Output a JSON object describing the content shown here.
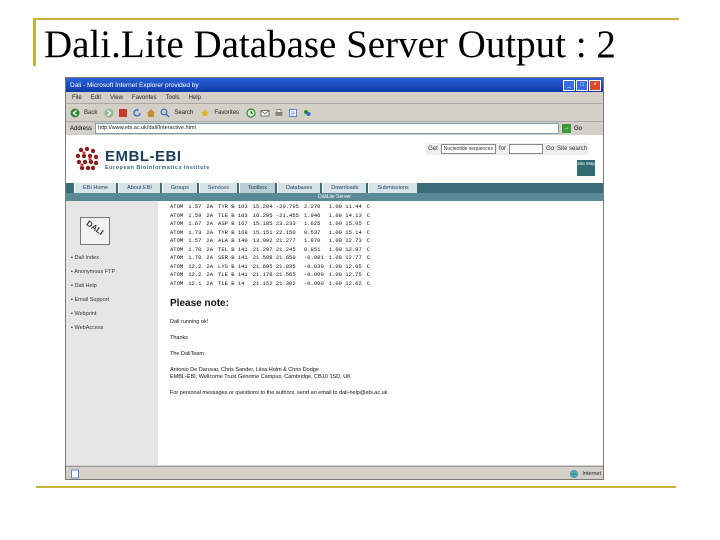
{
  "slide": {
    "title": "Dali.Lite Database Server Output : 2"
  },
  "browser": {
    "title": "Dali - Microsoft Internet Explorer provided by",
    "menu": [
      "File",
      "Edit",
      "View",
      "Favorites",
      "Tools",
      "Help"
    ],
    "toolbar": {
      "back": "Back",
      "search": "Search",
      "favorites": "Favorites"
    },
    "address_label": "Address",
    "address_value": "http://www.ebi.ac.uk/dali/Interactive.html",
    "go_label": "Go",
    "status_right": "Internet"
  },
  "site": {
    "logo_name": "EMBL-EBI",
    "logo_sub": "European Bioinformatics Institute",
    "search": {
      "get_label": "Get",
      "select_value": "Nucleotide sequences",
      "for_label": "for",
      "go_label": "Go",
      "site_search": "Site search"
    },
    "sitemap_label": "Site Map",
    "tabs": [
      "EBI Home",
      "About EBI",
      "Groups",
      "Services",
      "Toolbox",
      "Databases",
      "Downloads",
      "Submissions"
    ],
    "active_tab": "Toolbox",
    "subbar": "DaliLite Server",
    "left_logo": "DALI",
    "left_links": [
      "Dali Index",
      "Anonymous FTP",
      "Dali Help",
      "Email Support",
      "Webprint",
      "WebAccess"
    ]
  },
  "table": {
    "rows": [
      [
        "ATOM",
        "1.57",
        "2A",
        "TYR B 103",
        "15.204 -20.795",
        "2.270",
        "1.00 11.44",
        "C"
      ],
      [
        "ATOM",
        "1.59",
        "2A",
        "TLE B 103",
        "16.205 -21.455",
        "1.946",
        "1.00 14.13",
        "C"
      ],
      [
        "ATOM",
        "1.67",
        "2A",
        "ASP B 167",
        "15.185 23.233",
        "1.625",
        "1.00 15.05",
        "C"
      ],
      [
        "ATOM",
        "1.73",
        "2A",
        "TYR B 168",
        "15.151 22.150",
        "0.537",
        "1.00 15.14",
        "C"
      ],
      [
        "ATOM",
        "1.57",
        "2A",
        "ALA B 140",
        "13.002 21.277",
        "1.870",
        "1.00 12.73",
        "C"
      ],
      [
        "ATOM",
        "1.70",
        "2A",
        "TEL B 141",
        "21.207 21.245",
        "0.851",
        "1.00 12.97",
        "C"
      ],
      [
        "ATOM",
        "1.70",
        "2A",
        "SER B 141",
        "21.598 21.650",
        "-0.001",
        "1.00 12.77",
        "C"
      ],
      [
        "ATOM",
        "12.2",
        "2A",
        "LYS B 141",
        "21.695 21.935",
        "-0.030",
        "1.00 12.05",
        "C"
      ],
      [
        "ATOM",
        "12.2",
        "2A",
        "TLE B 141",
        "21.178 21.565",
        "-0.000",
        "1.00 12.75",
        "C"
      ],
      [
        "ATOM",
        "12.1",
        "2A",
        "TLE B 14",
        "21.152 21.302",
        "-0.000",
        "1.00 12.62",
        "C"
      ]
    ]
  },
  "note": {
    "heading": "Please note:",
    "lines": [
      "Dali running ok!",
      "Thanks",
      "The DaliTeam",
      "Antonio De Daruvar, Chris Sander, Liisa Holm & Chris Dodge",
      "EMBL-EBI, Wellcome Trust Genome Campus, Cambridge, CB10 1SD, UK",
      "For personal messages or questions to the authors, send an email to dali-help@ebi.ac.uk"
    ]
  },
  "colors": {
    "accent_gold": "#c8b23a",
    "ebi_teal": "#3c6b79",
    "title_blue": "#0f3aa8"
  }
}
